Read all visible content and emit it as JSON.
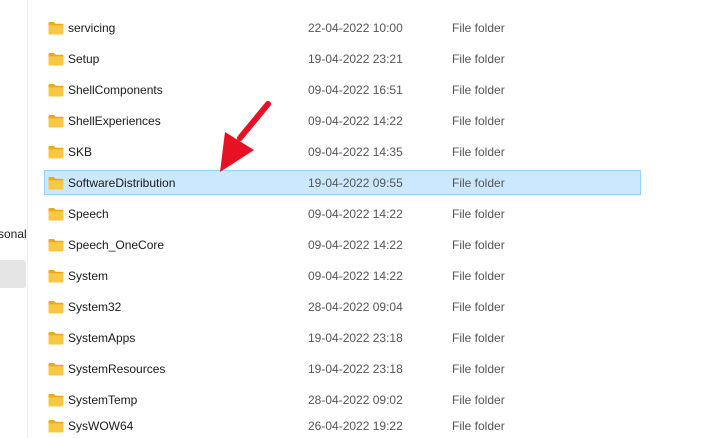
{
  "sidebar": {
    "items": [
      {
        "label": "sonal"
      }
    ]
  },
  "colors": {
    "folder_body": "#f8c844",
    "folder_tab": "#e8a91e",
    "selection_bg": "#cce8ff",
    "selection_border": "#99d1ff",
    "arrow": "#e81123"
  },
  "rows": [
    {
      "name": "servicing",
      "date": "22-04-2022 10:00",
      "type": "File folder"
    },
    {
      "name": "Setup",
      "date": "19-04-2022 23:21",
      "type": "File folder"
    },
    {
      "name": "ShellComponents",
      "date": "09-04-2022 16:51",
      "type": "File folder"
    },
    {
      "name": "ShellExperiences",
      "date": "09-04-2022 14:22",
      "type": "File folder"
    },
    {
      "name": "SKB",
      "date": "09-04-2022 14:35",
      "type": "File folder"
    },
    {
      "name": "SoftwareDistribution",
      "date": "19-04-2022 09:55",
      "type": "File folder"
    },
    {
      "name": "Speech",
      "date": "09-04-2022 14:22",
      "type": "File folder"
    },
    {
      "name": "Speech_OneCore",
      "date": "09-04-2022 14:22",
      "type": "File folder"
    },
    {
      "name": "System",
      "date": "09-04-2022 14:22",
      "type": "File folder"
    },
    {
      "name": "System32",
      "date": "28-04-2022 09:04",
      "type": "File folder"
    },
    {
      "name": "SystemApps",
      "date": "19-04-2022 23:18",
      "type": "File folder"
    },
    {
      "name": "SystemResources",
      "date": "19-04-2022 23:18",
      "type": "File folder"
    },
    {
      "name": "SystemTemp",
      "date": "28-04-2022 09:02",
      "type": "File folder"
    },
    {
      "name": "SysWOW64",
      "date": "26-04-2022 19:22",
      "type": "File folder"
    }
  ]
}
